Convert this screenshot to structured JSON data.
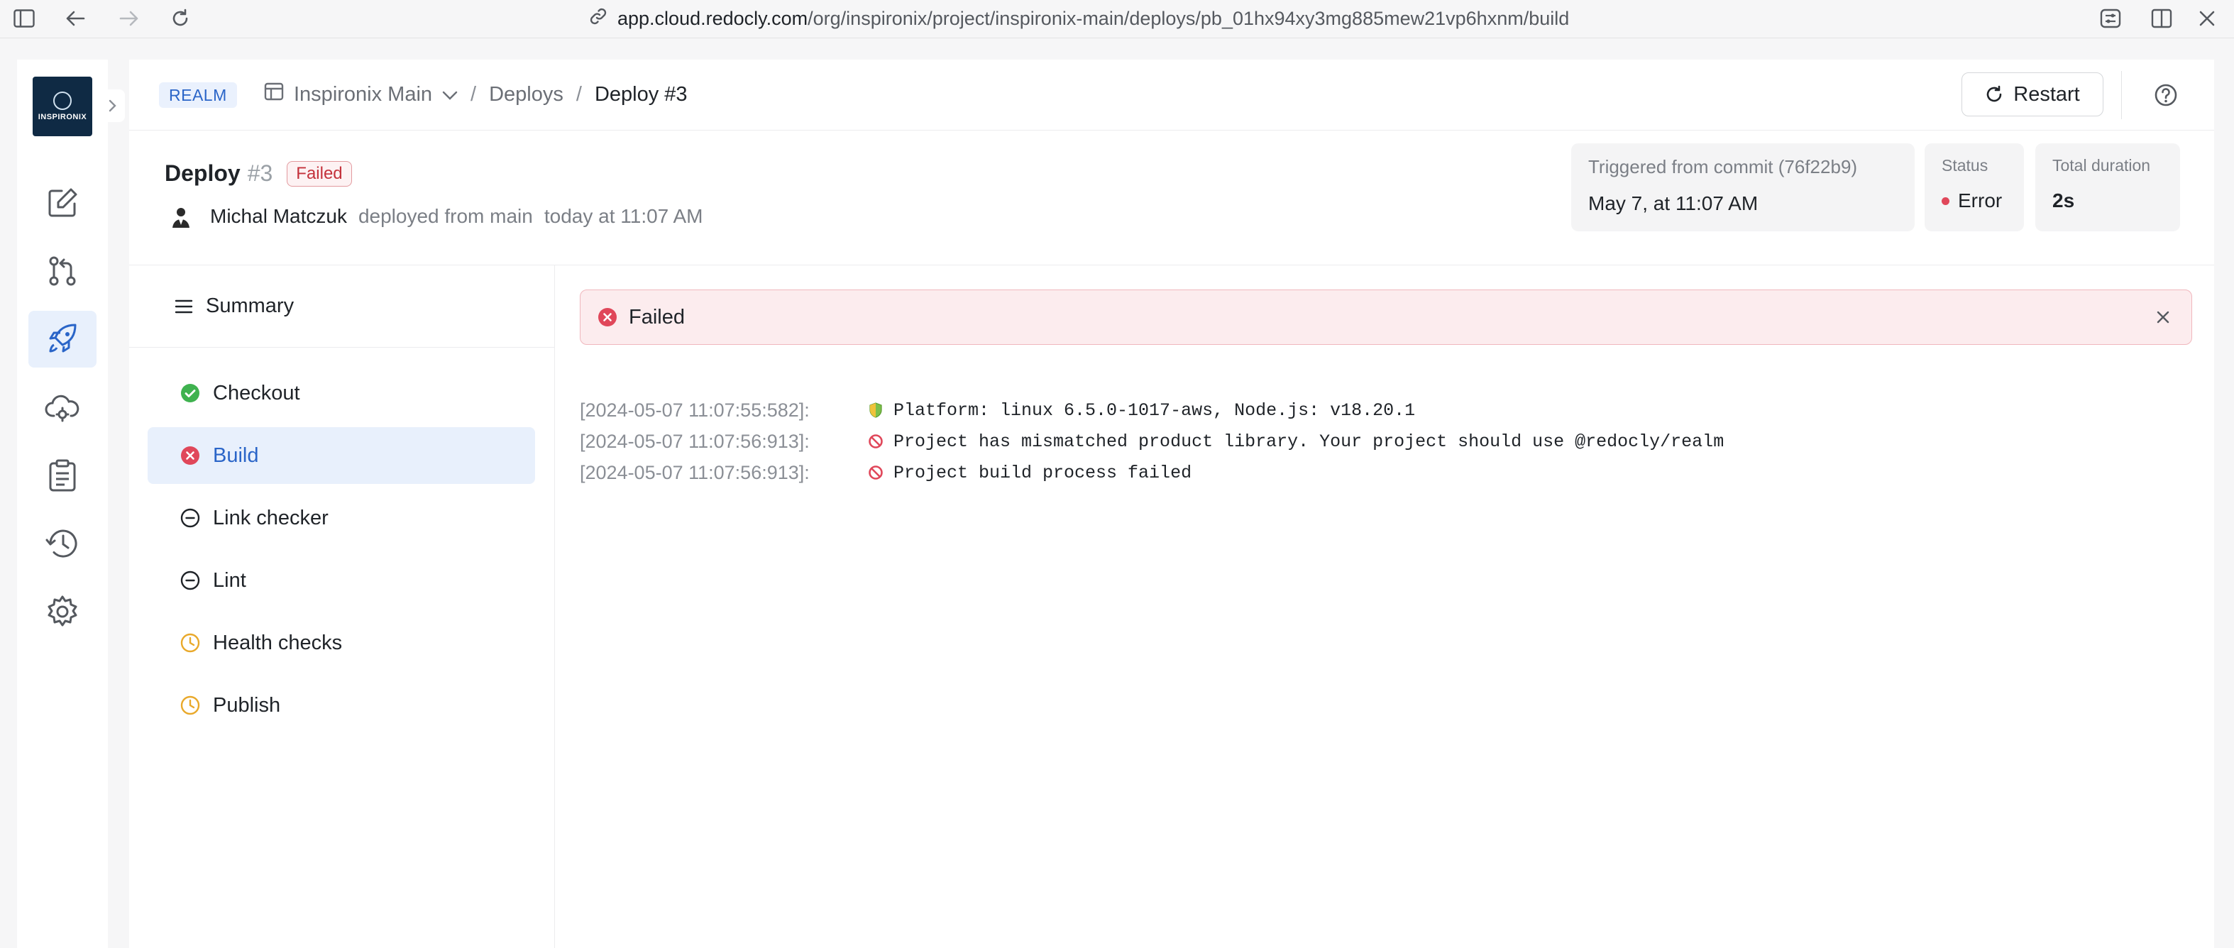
{
  "browser": {
    "url_host": "app.cloud.redocly.com",
    "url_path": "/org/inspironix/project/inspironix-main/deploys/pb_01hx94xy3mg885mew21vp6hxnm/build"
  },
  "rail": {
    "logo_text": "INSPIRONIX",
    "items": [
      "edit-icon",
      "pull-request-icon",
      "rocket-icon",
      "cloud-icon",
      "clipboard-icon",
      "history-icon",
      "gear-icon"
    ],
    "active_index": 2
  },
  "topbar": {
    "realm": "REALM",
    "breadcrumbs": [
      "Inspironix Main",
      "Deploys",
      "Deploy #3"
    ],
    "restart_label": "Restart"
  },
  "deploy": {
    "title": "Deploy",
    "number": "#3",
    "badge": "Failed",
    "author": "Michal Matczuk",
    "action": "deployed from main",
    "when": "today at 11:07 AM",
    "commit_label": "Triggered from commit (76f22b9)",
    "commit_time": "May 7, at 11:07 AM",
    "status_label": "Status",
    "status_value": "Error",
    "duration_label": "Total duration",
    "duration_value": "2s"
  },
  "steps": {
    "summary_label": "Summary",
    "items": [
      {
        "label": "Checkout",
        "state": "success"
      },
      {
        "label": "Build",
        "state": "failed"
      },
      {
        "label": "Link checker",
        "state": "skipped"
      },
      {
        "label": "Lint",
        "state": "skipped"
      },
      {
        "label": "Health checks",
        "state": "pending"
      },
      {
        "label": "Publish",
        "state": "pending"
      }
    ],
    "active_index": 1
  },
  "log": {
    "alert": "Failed",
    "lines": [
      {
        "ts": "[2024-05-07 11:07:55:582]:",
        "icon": "shield-icon",
        "msg": "Platform: linux 6.5.0-1017-aws, Node.js: v18.20.1"
      },
      {
        "ts": "[2024-05-07 11:07:56:913]:",
        "icon": "prohibited-icon",
        "msg": "Project has mismatched product library. Your project should use @redocly/realm"
      },
      {
        "ts": "[2024-05-07 11:07:56:913]:",
        "icon": "prohibited-icon",
        "msg": "Project build process failed"
      }
    ]
  },
  "colors": {
    "accent": "#2a65c8",
    "error": "#e0475a",
    "success": "#3fb24f",
    "pending": "#e9a92b"
  }
}
